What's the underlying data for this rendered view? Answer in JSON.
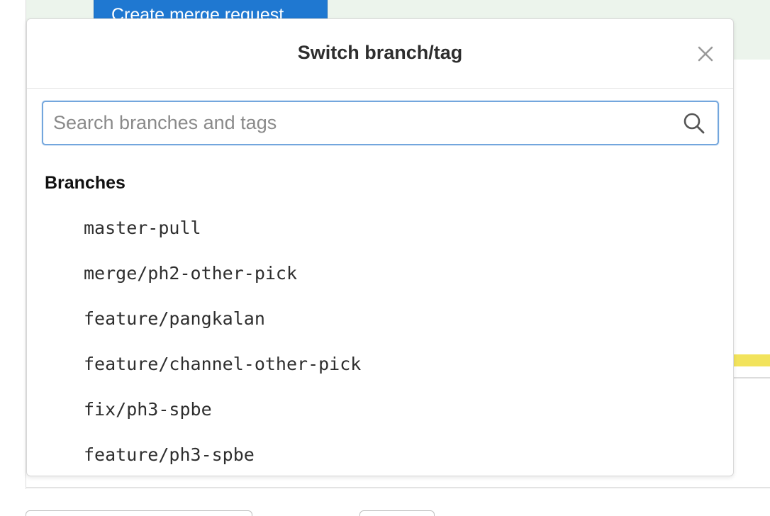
{
  "background": {
    "create_merge_request_label": "Create merge request",
    "banner_color": "#ecf4ec",
    "accent_blue": "#1f78d1",
    "accent_yellow": "#f2e35c"
  },
  "dropdown": {
    "title": "Switch branch/tag",
    "close_icon": "close-icon",
    "search": {
      "placeholder": "Search branches and tags",
      "value": "",
      "icon": "search-icon",
      "focus_color": "#73a6dd"
    },
    "sections": [
      {
        "header": "Branches",
        "items": [
          {
            "label": "master-pull"
          },
          {
            "label": "merge/ph2-other-pick"
          },
          {
            "label": "feature/pangkalan"
          },
          {
            "label": "feature/channel-other-pick"
          },
          {
            "label": "fix/ph3-spbe"
          },
          {
            "label": "feature/ph3-spbe"
          }
        ]
      }
    ]
  }
}
